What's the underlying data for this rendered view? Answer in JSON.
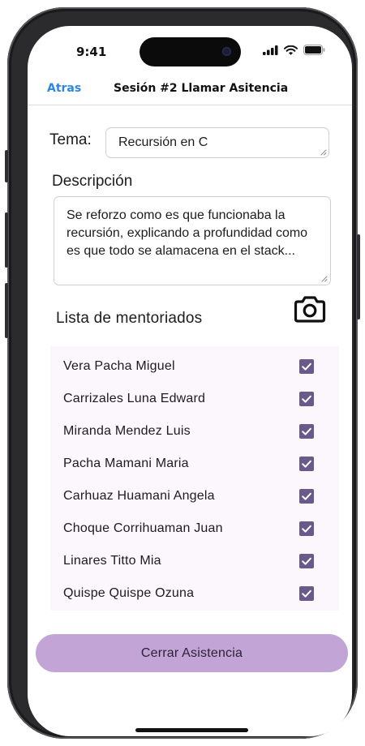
{
  "status_bar": {
    "time": "9:41"
  },
  "nav": {
    "back_label": "Atras",
    "title": "Sesión #2 Llamar Asitencia"
  },
  "tema": {
    "label": "Tema:",
    "value": "Recursión en C"
  },
  "descripcion": {
    "label": "Descripción",
    "text": "Se reforzo como es que funcionaba la recursión, explicando a profundidad como es que todo se alamacena en el stack..."
  },
  "mentoriados": {
    "title": "Lista de mentoriados",
    "camera_icon": "camera-icon",
    "items": [
      {
        "name": "Vera Pacha Miguel",
        "checked": true
      },
      {
        "name": "Carrizales Luna Edward",
        "checked": true
      },
      {
        "name": "Miranda Mendez Luis",
        "checked": true
      },
      {
        "name": "Pacha Mamani Maria",
        "checked": true
      },
      {
        "name": "Carhuaz Huamani Angela",
        "checked": true
      },
      {
        "name": "Choque Corrihuaman Juan",
        "checked": true
      },
      {
        "name": "Linares Titto Mia",
        "checked": true
      },
      {
        "name": "Quispe Quispe Ozuna",
        "checked": true
      }
    ]
  },
  "actions": {
    "close_label": "Cerrar Asistencia"
  },
  "colors": {
    "accent_link": "#2a86e8",
    "checkbox": "#6a5a8c",
    "button": "#c2a4d6",
    "list_bg": "#fcf7fd"
  }
}
